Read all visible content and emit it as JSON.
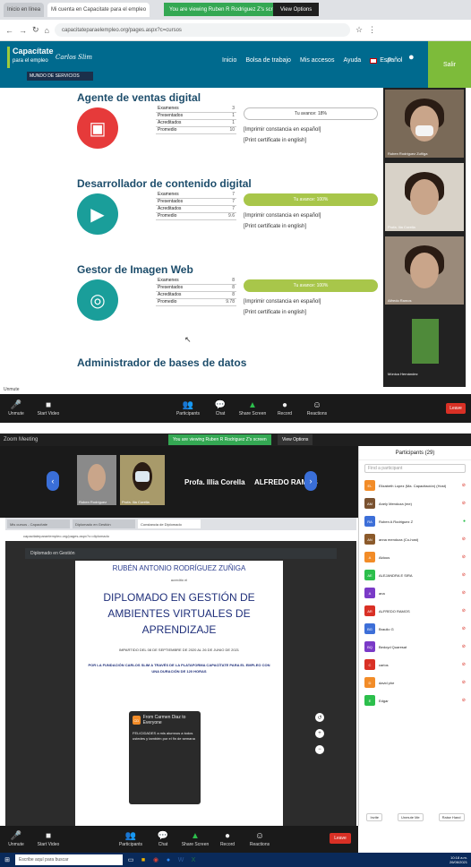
{
  "shot1": {
    "tabs": [
      "Inicio en línea",
      "Mi cuenta en Capacitate para el empleo"
    ],
    "share_banner": "You are viewing Ruben R Rodriguez Z's screen",
    "view_options": "View Options",
    "url": "capacitateparaelempleo.org/pages.aspx?c=cursos",
    "site": {
      "logo_line1": "Capacítate",
      "logo_line2": "para el empleo",
      "logo_script": "Carlos Slim",
      "mundo": "MUNDO DE SERVICIOS",
      "nav": [
        "Inicio",
        "Bolsa de trabajo",
        "Mis accesos",
        "Ayuda"
      ],
      "lang": "Español",
      "exit": "Salir"
    },
    "stat_labels": [
      "Examenes",
      "Presentados",
      "Acreditados",
      "Promedio"
    ],
    "courses": [
      {
        "title": "Agente de ventas digital",
        "stats": [
          "3",
          "1",
          "1",
          "10"
        ],
        "progress": "Tu avance: 18%",
        "done": false,
        "color": "#e63a3a",
        "icon": "computer-icon"
      },
      {
        "title": "Desarrollador de contenido digital",
        "stats": [
          "7",
          "7",
          "7",
          "9.6"
        ],
        "progress": "Tu avance: 100%",
        "done": true,
        "color": "#1a9e9a",
        "icon": "video-content-icon"
      },
      {
        "title": "Gestor de Imagen Web",
        "stats": [
          "8",
          "8",
          "8",
          "9.78"
        ],
        "progress": "Tu avance: 100%",
        "done": true,
        "color": "#1a9e9a",
        "icon": "image-web-icon"
      },
      {
        "title": "Administrador de bases de datos",
        "stats": [],
        "progress": "",
        "done": false,
        "color": "#1a9e9a",
        "icon": "database-icon"
      }
    ],
    "cert_es": "[Imprimir constancia en español]",
    "cert_en": "[Print certificate in english]",
    "videos": [
      "Ruben Rodriguez Zuñiga",
      "Profa. Ilia Corella",
      "Alfredo Ramos",
      "Mónica Hernández"
    ],
    "meeting_label": "Unmute",
    "toolbar": [
      "Unmute",
      "Start Video",
      "Participants",
      "Chat",
      "Share Screen",
      "Record",
      "Reactions"
    ],
    "end": "Leave"
  },
  "shot2": {
    "title": "Zoom Meeting",
    "share_banner": "You are viewing Ruben R Rodriguez Z's screen",
    "view_options": "View Options",
    "gallery_names": [
      "Ruben Rodriguez",
      "Profa. Ilia Corella"
    ],
    "speaker_names": [
      "Profa. Illia Corella",
      "ALFREDO RAMOS"
    ],
    "viewer_title": "Diplomado en Gestión",
    "inner_tabs": [
      "Mis cursos - Capacítate",
      "Diplomado en Gestión",
      "Constancia de Diplomado"
    ],
    "inner_url": "capacitateparaelempleo.org/pages.aspx?c=diplomado",
    "pdf": {
      "name": "RUBÉN ANTONIO RODRÍGUEZ ZUÑIGA",
      "small": "acreditó el",
      "big": "DIPLOMADO EN GESTIÓN DE AMBIENTES VIRTUALES DE APRENDIZAJE",
      "para1": "IMPARTIDO DEL 08 DE SEPTIEMBRE DE 2020 AL 26 DE JUNIO DE 2021",
      "para2": "POR LA FUNDACIÓN CARLOS SLIM A TRAVÉS DE LA PLATAFORMA CAPACÍTATE PARA EL EMPLEO CON UNA DURACIÓN DE 120 HORAS"
    },
    "toast": {
      "from": "From Carmen Diaz to Everyone",
      "msg": "FELICIDADES a mis alumnos a todos ustedes y también por el fin de semana"
    },
    "participants_title": "Participants (29)",
    "search_placeholder": "Find a participant",
    "participants": [
      {
        "name": "Elizabeth Lopez (Ma. Capacitación) (Host)",
        "color": "#f28c28",
        "initials": "EL"
      },
      {
        "name": "Anely Mendoza (me)",
        "color": "#7a5230",
        "initials": "AM"
      },
      {
        "name": "Ruben A Rodriguez Z",
        "color": "#3d6fd8",
        "initials": "RA"
      },
      {
        "name": "anna mendoza (Co-host)",
        "color": "#8b5a2b",
        "initials": "AN"
      },
      {
        "name": "Aldous",
        "color": "#f28c28",
        "initials": "A"
      },
      {
        "name": "ALEJANDRA E SIRA",
        "color": "#2cbf4c",
        "initials": "AE"
      },
      {
        "name": "ana",
        "color": "#7a3ac7",
        "initials": "A"
      },
      {
        "name": "ALFREDO RAMOS",
        "color": "#d93025",
        "initials": "AR"
      },
      {
        "name": "Braulio G",
        "color": "#3d6fd8",
        "initials": "BG"
      },
      {
        "name": "Bedoyd Quaresat",
        "color": "#7a3ac7",
        "initials": "BQ"
      },
      {
        "name": "carlos",
        "color": "#d93025",
        "initials": "C"
      },
      {
        "name": "david phe",
        "color": "#f28c28",
        "initials": "D"
      },
      {
        "name": "Edgar",
        "color": "#2cbf4c",
        "initials": "E"
      }
    ],
    "p_footer": [
      "Invite",
      "Unmute Me",
      "Raise Hand"
    ],
    "toolbar": [
      "Unmute",
      "Start Video",
      "Participants",
      "Chat",
      "Share Screen",
      "Record",
      "Reactions"
    ],
    "end": "Leave",
    "taskbar_search": "Escribe aquí para buscar",
    "clock": [
      "10:18 a.m.",
      "26/06/2021"
    ]
  }
}
